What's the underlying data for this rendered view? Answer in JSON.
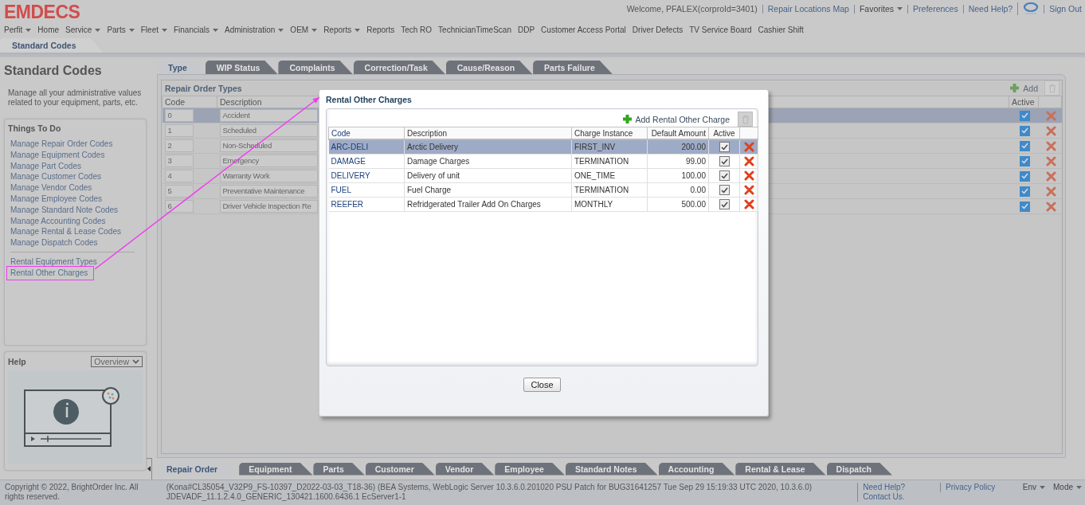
{
  "header": {
    "logo": "EMDECS",
    "welcome": "Welcome, PFALEX(corproId=3401)",
    "links": [
      {
        "label": "Repair Locations Map",
        "kind": "link"
      },
      {
        "label": "Favorites",
        "kind": "menu"
      },
      {
        "label": "Preferences",
        "kind": "link"
      },
      {
        "label": "Need Help?",
        "kind": "link"
      },
      {
        "kind": "icon"
      },
      {
        "label": "Sign Out",
        "kind": "link"
      }
    ]
  },
  "nav": [
    {
      "label": "Perfit",
      "menu": true
    },
    {
      "label": "Home",
      "menu": false
    },
    {
      "label": "Service",
      "menu": true
    },
    {
      "label": "Parts",
      "menu": true
    },
    {
      "label": "Fleet",
      "menu": true
    },
    {
      "label": "Financials",
      "menu": true
    },
    {
      "label": "Administration",
      "menu": true
    },
    {
      "label": "OEM",
      "menu": true
    },
    {
      "label": "Reports",
      "menu": true
    },
    {
      "label": "Reports",
      "menu": false
    },
    {
      "label": "Tech RO",
      "menu": false
    },
    {
      "label": "TechnicianTimeScan",
      "menu": false
    },
    {
      "label": "DDP",
      "menu": false
    },
    {
      "label": "Customer Access Portal",
      "menu": false
    },
    {
      "label": "Driver Defects",
      "menu": false
    },
    {
      "label": "TV Service Board",
      "menu": false
    },
    {
      "label": "Cashier Shift",
      "menu": false
    }
  ],
  "page_tabs": [
    {
      "label": "Standard Codes",
      "selected": true
    }
  ],
  "sidebar": {
    "title": "Standard Codes",
    "description": "Manage all your administrative values related to your equipment, parts, etc.",
    "things_to_do": {
      "title": "Things To Do",
      "groups": [
        [
          {
            "label": "Manage Repair Order Codes",
            "highlighted": false
          },
          {
            "label": "Manage Equipment Codes",
            "highlighted": false
          },
          {
            "label": "Manage Part Codes",
            "highlighted": false
          },
          {
            "label": "Manage Customer Codes",
            "highlighted": false
          },
          {
            "label": "Manage Vendor Codes",
            "highlighted": false
          },
          {
            "label": "Manage Employee Codes",
            "highlighted": false
          },
          {
            "label": "Manage Standard Note Codes",
            "highlighted": false
          },
          {
            "label": "Manage Accounting Codes",
            "highlighted": false
          },
          {
            "label": "Manage Rental & Lease Codes",
            "highlighted": false
          },
          {
            "label": "Manage Dispatch Codes",
            "highlighted": false
          }
        ],
        [
          {
            "label": "Rental Equipment Types",
            "highlighted": false
          },
          {
            "label": "Rental Other Charges",
            "highlighted": true
          }
        ]
      ]
    },
    "help": {
      "title": "Help",
      "dropdown": "Overview"
    }
  },
  "top_tabs": [
    {
      "label": "Type",
      "selected": true
    },
    {
      "label": "WIP Status",
      "selected": false
    },
    {
      "label": "Complaints",
      "selected": false
    },
    {
      "label": "Correction/Task",
      "selected": false
    },
    {
      "label": "Cause/Reason",
      "selected": false
    },
    {
      "label": "Parts Failure",
      "selected": false
    }
  ],
  "panel": {
    "title": "Repair Order Types",
    "add_button": "Add",
    "columns": [
      "Code",
      "Description",
      "Active"
    ],
    "rows": [
      {
        "code": "0",
        "description": "Accident",
        "active": true,
        "selected": true
      },
      {
        "code": "1",
        "description": "Scheduled",
        "active": true,
        "selected": false
      },
      {
        "code": "2",
        "description": "Non-Scheduled",
        "active": true,
        "selected": false
      },
      {
        "code": "3",
        "description": "Emergency",
        "active": true,
        "selected": false
      },
      {
        "code": "4",
        "description": "Warranty Work",
        "active": true,
        "selected": false
      },
      {
        "code": "5",
        "description": "Preventative Maintenance",
        "active": true,
        "selected": false
      },
      {
        "code": "6",
        "description": "Driver Vehicle Inspection Re",
        "active": true,
        "selected": false
      }
    ]
  },
  "bottom_tabs": [
    {
      "label": "Repair Order",
      "selected": true
    },
    {
      "label": "Equipment",
      "selected": false
    },
    {
      "label": "Parts",
      "selected": false
    },
    {
      "label": "Customer",
      "selected": false
    },
    {
      "label": "Vendor",
      "selected": false
    },
    {
      "label": "Employee",
      "selected": false
    },
    {
      "label": "Standard Notes",
      "selected": false
    },
    {
      "label": "Accounting",
      "selected": false
    },
    {
      "label": "Rental & Lease",
      "selected": false
    },
    {
      "label": "Dispatch",
      "selected": false
    }
  ],
  "footer": {
    "copyright": "Copyright © 2022, BrightOrder Inc. All rights reserved.",
    "build": "(Kona#CL35054_V32P9_FS-10397_D2022-03-03_T18-36) (BEA Systems, WebLogic Server 10.3.6.0.201020 PSU Patch for BUG31641257 Tue Sep 29 15:19:33 UTC 2020, 10.3.6.0) JDEVADF_11.1.2.4.0_GENERIC_130421.1600.6436.1 EcServer1-1",
    "links": [
      {
        "label": "Need Help? Contact Us.",
        "menu": false
      },
      {
        "label": "Privacy Policy",
        "menu": false
      },
      {
        "label": "Env",
        "menu": true
      },
      {
        "label": "Mode",
        "menu": true
      }
    ]
  },
  "dialog": {
    "title": "Rental Other Charges",
    "add_button": "Add Rental Other Charge",
    "columns": [
      "Code",
      "Description",
      "Charge Instance",
      "Default Amount",
      "Active"
    ],
    "rows": [
      {
        "code": "ARC-DELI",
        "description": "Arctic Delivery",
        "charge_instance": "FIRST_INV",
        "default_amount": "200.00",
        "active": true,
        "selected": true
      },
      {
        "code": "DAMAGE",
        "description": "Damage Charges",
        "charge_instance": "TERMINATION",
        "default_amount": "99.00",
        "active": true,
        "selected": false
      },
      {
        "code": "DELIVERY",
        "description": "Delivery of unit",
        "charge_instance": "ONE_TIME",
        "default_amount": "100.00",
        "active": true,
        "selected": false
      },
      {
        "code": "FUEL",
        "description": "Fuel Charge",
        "charge_instance": "TERMINATION",
        "default_amount": "0.00",
        "active": true,
        "selected": false
      },
      {
        "code": "REEFER",
        "description": "Refridgerated Trailer Add On Charges",
        "charge_instance": "MONTHLY",
        "default_amount": "500.00",
        "active": true,
        "selected": false
      }
    ],
    "close_button": "Close"
  }
}
